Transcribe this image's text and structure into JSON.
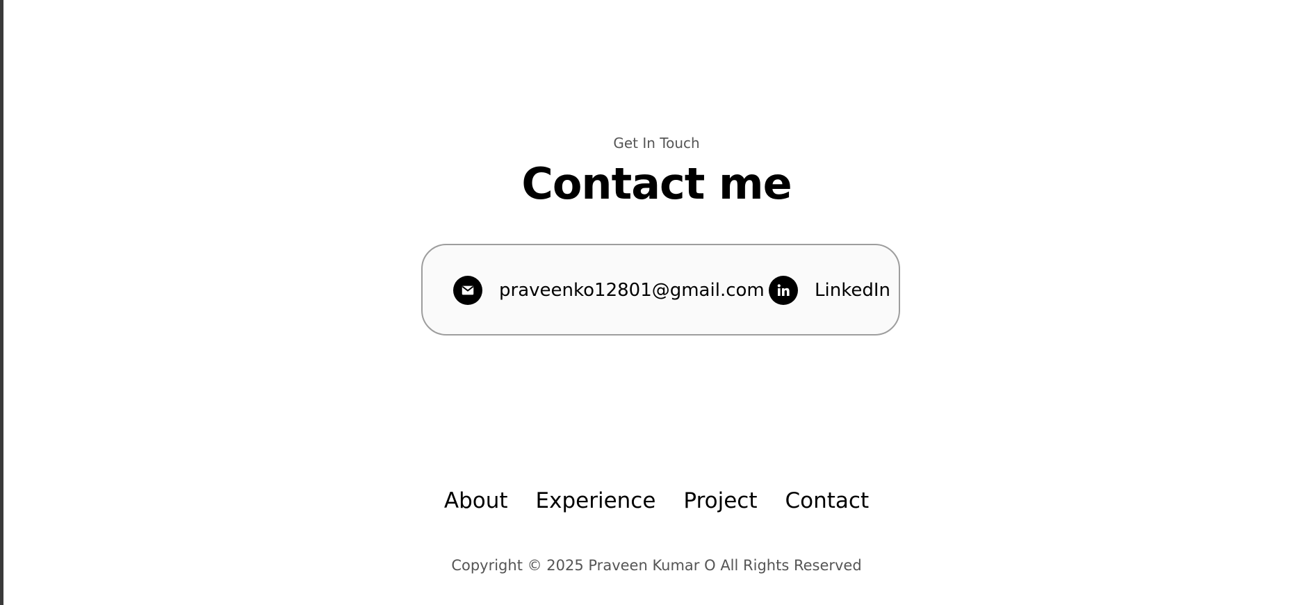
{
  "contact": {
    "subtitle": "Get In Touch",
    "title": "Contact me",
    "email": {
      "icon": "email-icon",
      "label": "praveenko12801@gmail.com"
    },
    "linkedin": {
      "icon": "linkedin-icon",
      "label": "LinkedIn"
    }
  },
  "footer": {
    "nav": [
      {
        "label": "About"
      },
      {
        "label": "Experience"
      },
      {
        "label": "Project"
      },
      {
        "label": "Contact"
      }
    ],
    "copyright": "Copyright © 2025 Praveen Kumar O All Rights Reserved"
  },
  "colors": {
    "background": "#ffffff",
    "text": "#000000",
    "muted": "#555555",
    "box_border": "#9d9d9d",
    "box_fill": "#fafafa"
  }
}
